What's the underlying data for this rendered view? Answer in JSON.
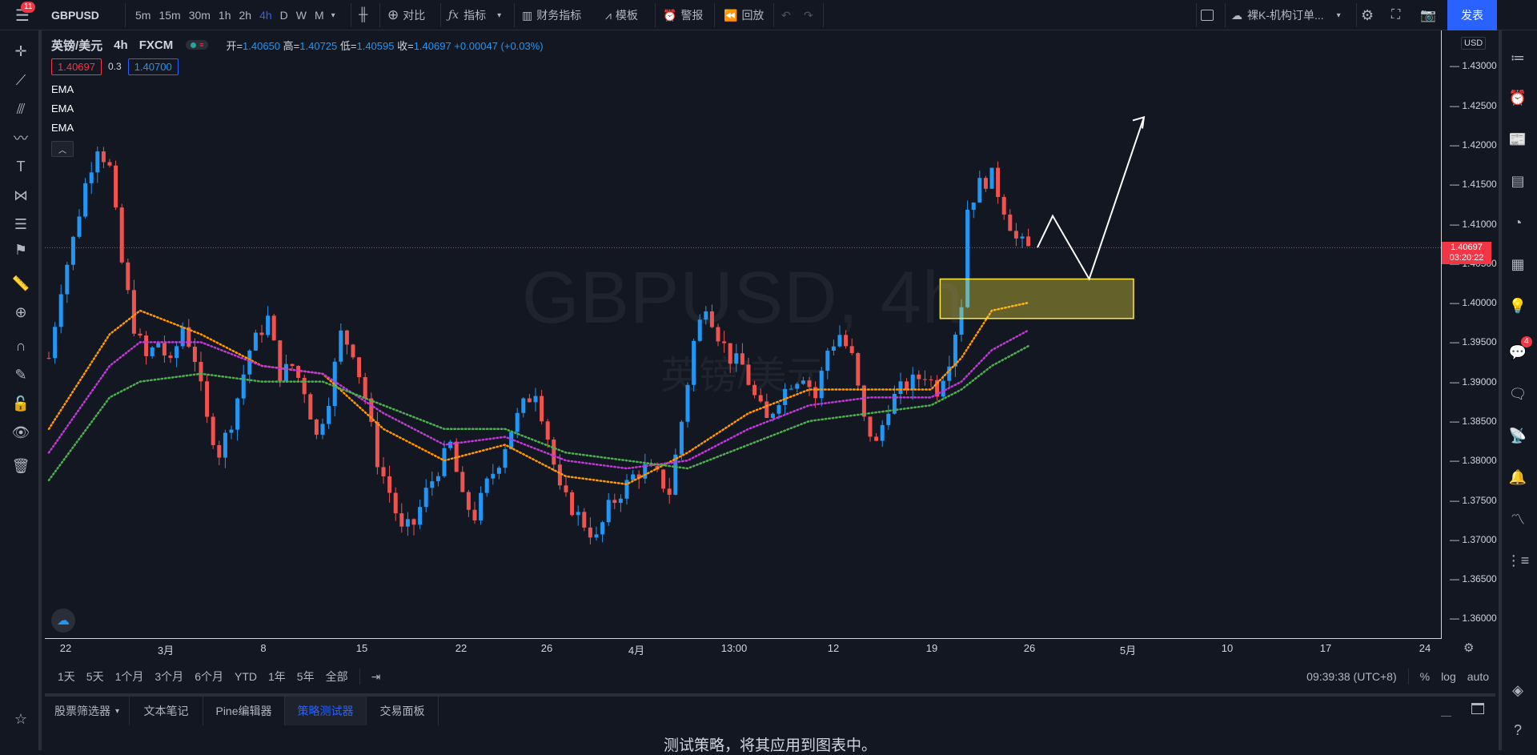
{
  "topbar": {
    "menu_badge": "11",
    "symbol": "GBPUSD",
    "intervals": [
      "5m",
      "15m",
      "30m",
      "1h",
      "2h",
      "4h",
      "D",
      "W",
      "M"
    ],
    "active_interval": "4h",
    "compare": "对比",
    "indicators": "指标",
    "financials": "财务指标",
    "templates": "模板",
    "alert": "警报",
    "replay": "回放",
    "layout_name": "裸K-机构订单...",
    "publish": "发表"
  },
  "legend": {
    "name": "英镑/美元",
    "interval": "4h",
    "exchange": "FXCM",
    "open_label": "开=",
    "open": "1.40650",
    "high_label": "高=",
    "high": "1.40725",
    "low_label": "低=",
    "low": "1.40595",
    "close_label": "收=",
    "close": "1.40697",
    "change": "+0.00047 (+0.03%)",
    "bid": "1.40697",
    "spread": "0.3",
    "ask": "1.40700",
    "indicators": [
      "EMA",
      "EMA",
      "EMA"
    ]
  },
  "watermark": {
    "symbol": "GBPUSD, 4h",
    "name": "英镑/美元"
  },
  "price_axis": {
    "currency": "USD",
    "ticks": [
      "1.43000",
      "1.42500",
      "1.42000",
      "1.41500",
      "1.41000",
      "1.40500",
      "1.40000",
      "1.39500",
      "1.39000",
      "1.38500",
      "1.38000",
      "1.37500",
      "1.37000",
      "1.36500",
      "1.36000"
    ],
    "current_price": "1.40697",
    "countdown": "03:20:22"
  },
  "time_axis": {
    "ticks": [
      "22",
      "3月",
      "8",
      "15",
      "22",
      "26",
      "4月",
      "13:00",
      "12",
      "19",
      "26",
      "5月",
      "10",
      "17",
      "24"
    ]
  },
  "range_bar": {
    "ranges": [
      "1天",
      "5天",
      "1个月",
      "3个月",
      "6个月",
      "YTD",
      "1年",
      "5年",
      "全部"
    ],
    "clock": "09:39:38 (UTC+8)",
    "percent": "%",
    "log": "log",
    "auto": "auto"
  },
  "bottom_panel": {
    "tabs": [
      "股票筛选器",
      "文本笔记",
      "Pine编辑器",
      "策略测试器",
      "交易面板"
    ],
    "active_tab": "策略测试器",
    "message": "测试策略，将其应用到图表中。"
  },
  "right_sidebar": {
    "badge": "4"
  },
  "colors": {
    "up": "#2196f3",
    "down": "#ef5350",
    "ema_fast": "#ff9800",
    "ema_mid": "#c039d6",
    "ema_slow": "#4caf50",
    "zone_border": "#ffeb3b",
    "accent": "#2962ff",
    "price_label": "#f23645"
  },
  "chart_data": {
    "type": "candlestick",
    "symbol": "GBPUSD",
    "ylim": [
      1.3575,
      1.4345
    ],
    "current_price": 1.40697,
    "anchors": [
      [
        0,
        1.393
      ],
      [
        2,
        1.402
      ],
      [
        4,
        1.408
      ],
      [
        6,
        1.415
      ],
      [
        8,
        1.42
      ],
      [
        10,
        1.417
      ],
      [
        12,
        1.405
      ],
      [
        14,
        1.397
      ],
      [
        16,
        1.393
      ],
      [
        18,
        1.395
      ],
      [
        20,
        1.392
      ],
      [
        22,
        1.397
      ],
      [
        24,
        1.393
      ],
      [
        26,
        1.385
      ],
      [
        28,
        1.381
      ],
      [
        30,
        1.385
      ],
      [
        33,
        1.394
      ],
      [
        36,
        1.398
      ],
      [
        38,
        1.391
      ],
      [
        40,
        1.392
      ],
      [
        42,
        1.389
      ],
      [
        44,
        1.383
      ],
      [
        46,
        1.388
      ],
      [
        48,
        1.396
      ],
      [
        50,
        1.394
      ],
      [
        52,
        1.388
      ],
      [
        54,
        1.38
      ],
      [
        56,
        1.376
      ],
      [
        58,
        1.371
      ],
      [
        60,
        1.372
      ],
      [
        62,
        1.376
      ],
      [
        64,
        1.379
      ],
      [
        66,
        1.382
      ],
      [
        68,
        1.375
      ],
      [
        70,
        1.373
      ],
      [
        72,
        1.377
      ],
      [
        74,
        1.38
      ],
      [
        76,
        1.384
      ],
      [
        78,
        1.387
      ],
      [
        80,
        1.389
      ],
      [
        82,
        1.383
      ],
      [
        84,
        1.376
      ],
      [
        86,
        1.374
      ],
      [
        88,
        1.372
      ],
      [
        90,
        1.37
      ],
      [
        92,
        1.374
      ],
      [
        94,
        1.376
      ],
      [
        96,
        1.378
      ],
      [
        98,
        1.379
      ],
      [
        100,
        1.378
      ],
      [
        102,
        1.376
      ],
      [
        104,
        1.385
      ],
      [
        106,
        1.395
      ],
      [
        108,
        1.4
      ],
      [
        110,
        1.396
      ],
      [
        112,
        1.393
      ],
      [
        114,
        1.392
      ],
      [
        116,
        1.388
      ],
      [
        118,
        1.385
      ],
      [
        120,
        1.388
      ],
      [
        122,
        1.39
      ],
      [
        124,
        1.391
      ],
      [
        126,
        1.388
      ],
      [
        128,
        1.394
      ],
      [
        130,
        1.396
      ],
      [
        132,
        1.393
      ],
      [
        134,
        1.385
      ],
      [
        136,
        1.382
      ],
      [
        138,
        1.387
      ],
      [
        140,
        1.389
      ],
      [
        142,
        1.39
      ],
      [
        144,
        1.391
      ],
      [
        146,
        1.389
      ],
      [
        148,
        1.393
      ],
      [
        150,
        1.4
      ],
      [
        151,
        1.412
      ],
      [
        153,
        1.415
      ],
      [
        155,
        1.416
      ],
      [
        157,
        1.412
      ],
      [
        159,
        1.408
      ],
      [
        161,
        1.4068
      ]
    ],
    "ema_series": [
      {
        "name": "EMA",
        "color": "#ff9800",
        "start": 1.384,
        "points": [
          [
            0,
            1.384
          ],
          [
            10,
            1.396
          ],
          [
            15,
            1.399
          ],
          [
            25,
            1.396
          ],
          [
            35,
            1.392
          ],
          [
            45,
            1.391
          ],
          [
            55,
            1.384
          ],
          [
            65,
            1.38
          ],
          [
            75,
            1.382
          ],
          [
            85,
            1.378
          ],
          [
            95,
            1.377
          ],
          [
            105,
            1.381
          ],
          [
            115,
            1.386
          ],
          [
            125,
            1.389
          ],
          [
            135,
            1.389
          ],
          [
            145,
            1.389
          ],
          [
            150,
            1.393
          ],
          [
            155,
            1.399
          ],
          [
            161,
            1.4
          ]
        ]
      },
      {
        "name": "EMA",
        "color": "#c039d6",
        "points": [
          [
            0,
            1.381
          ],
          [
            10,
            1.392
          ],
          [
            15,
            1.395
          ],
          [
            25,
            1.395
          ],
          [
            35,
            1.392
          ],
          [
            45,
            1.391
          ],
          [
            55,
            1.386
          ],
          [
            65,
            1.382
          ],
          [
            75,
            1.383
          ],
          [
            85,
            1.38
          ],
          [
            95,
            1.379
          ],
          [
            105,
            1.38
          ],
          [
            115,
            1.384
          ],
          [
            125,
            1.387
          ],
          [
            135,
            1.388
          ],
          [
            145,
            1.388
          ],
          [
            150,
            1.39
          ],
          [
            155,
            1.394
          ],
          [
            161,
            1.3965
          ]
        ]
      },
      {
        "name": "EMA",
        "color": "#4caf50",
        "points": [
          [
            0,
            1.3775
          ],
          [
            10,
            1.388
          ],
          [
            15,
            1.39
          ],
          [
            25,
            1.391
          ],
          [
            35,
            1.39
          ],
          [
            45,
            1.39
          ],
          [
            55,
            1.387
          ],
          [
            65,
            1.384
          ],
          [
            75,
            1.384
          ],
          [
            85,
            1.381
          ],
          [
            95,
            1.38
          ],
          [
            105,
            1.379
          ],
          [
            115,
            1.382
          ],
          [
            125,
            1.385
          ],
          [
            135,
            1.386
          ],
          [
            145,
            1.387
          ],
          [
            150,
            1.389
          ],
          [
            155,
            1.392
          ],
          [
            161,
            1.3945
          ]
        ]
      }
    ],
    "zone": {
      "from_price": 1.398,
      "to_price": 1.403
    },
    "projection": [
      [
        1.407
      ],
      [
        1.411
      ],
      [
        1.403
      ],
      [
        1.4235
      ]
    ]
  }
}
